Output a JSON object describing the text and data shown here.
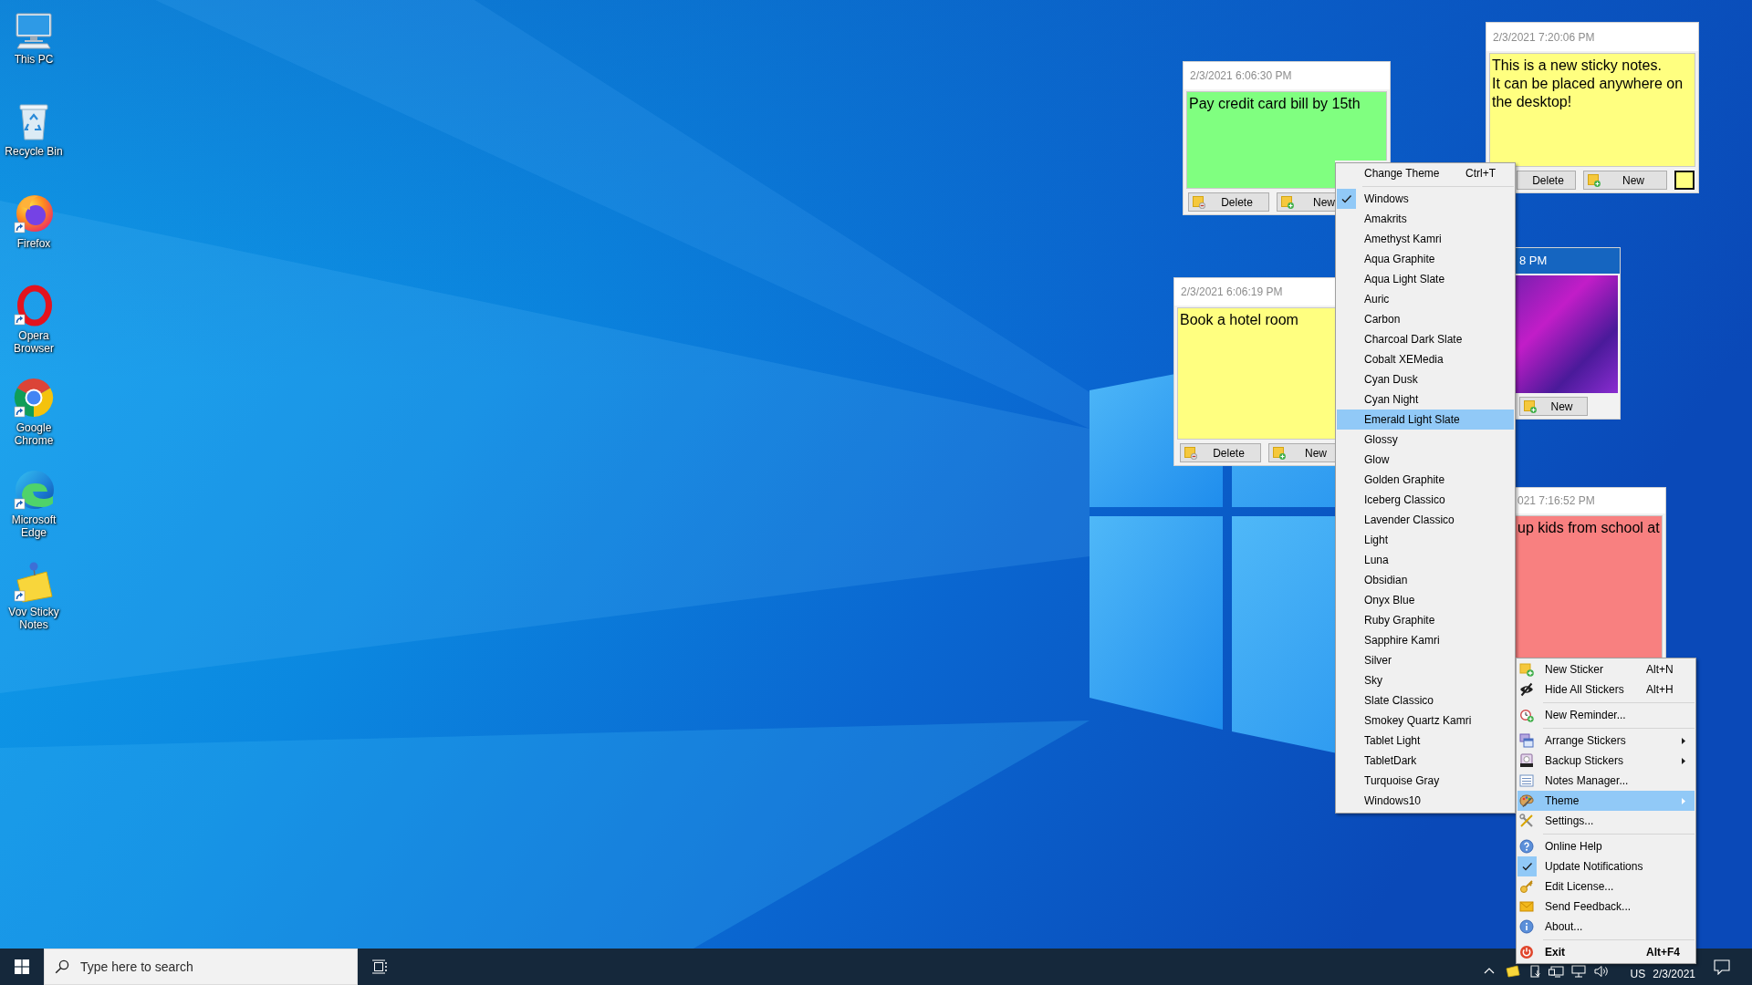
{
  "desktop_icons": [
    {
      "label": "This PC",
      "shortcut": false
    },
    {
      "label": "Recycle Bin",
      "shortcut": false
    },
    {
      "label": "Firefox",
      "shortcut": true
    },
    {
      "label": "Opera Browser",
      "shortcut": true
    },
    {
      "label": "Google Chrome",
      "shortcut": true
    },
    {
      "label": "Microsoft Edge",
      "shortcut": true
    },
    {
      "label": "Vov Sticky Notes",
      "shortcut": true
    }
  ],
  "notes": [
    {
      "kind": "text",
      "date": "2/3/2021 6:06:30 PM",
      "text": "Pay credit card bill by 15th",
      "color": "#80ff80",
      "active": false,
      "color_button": false,
      "buttons": [
        {
          "kind": "delete",
          "label": "Delete",
          "icon": true
        },
        {
          "kind": "new",
          "label": "New",
          "icon": true
        }
      ]
    },
    {
      "kind": "text",
      "date": "2/3/2021 7:20:06 PM",
      "text": "This is a new sticky notes.\nIt can be placed anywhere on the desktop!",
      "color": "#ffff80",
      "active": false,
      "color_button": true,
      "buttons": [
        {
          "kind": "delete",
          "label": "Delete",
          "icon": false
        },
        {
          "kind": "new",
          "label": "New",
          "icon": true
        }
      ]
    },
    {
      "kind": "text",
      "date": "2/3/2021 6:06:19 PM",
      "text": "Book a hotel room",
      "color": "#ffff80",
      "active": false,
      "color_button": false,
      "buttons": [
        {
          "kind": "delete",
          "label": "Delete",
          "icon": true
        },
        {
          "kind": "new",
          "label": "New",
          "icon": true
        }
      ]
    },
    {
      "kind": "photo",
      "date": "8 PM",
      "active": true,
      "color_button": false,
      "buttons": [
        {
          "kind": "new",
          "label": "New",
          "icon": true
        }
      ]
    },
    {
      "kind": "text",
      "date": "021 7:16:52 PM",
      "text": "up kids from school at",
      "color": "#f88080",
      "active": false
    }
  ],
  "theme_menu": {
    "title": {
      "label": "Change Theme",
      "shortcut": "Ctrl+T"
    },
    "items": [
      {
        "label": "Windows",
        "checked": true,
        "selected": false
      },
      {
        "label": "Amakrits",
        "checked": false,
        "selected": false
      },
      {
        "label": "Amethyst Kamri",
        "checked": false,
        "selected": false
      },
      {
        "label": "Aqua Graphite",
        "checked": false,
        "selected": false
      },
      {
        "label": "Aqua Light Slate",
        "checked": false,
        "selected": false
      },
      {
        "label": "Auric",
        "checked": false,
        "selected": false
      },
      {
        "label": "Carbon",
        "checked": false,
        "selected": false
      },
      {
        "label": "Charcoal Dark Slate",
        "checked": false,
        "selected": false
      },
      {
        "label": "Cobalt XEMedia",
        "checked": false,
        "selected": false
      },
      {
        "label": "Cyan Dusk",
        "checked": false,
        "selected": false
      },
      {
        "label": "Cyan Night",
        "checked": false,
        "selected": false
      },
      {
        "label": "Emerald Light Slate",
        "checked": false,
        "selected": true
      },
      {
        "label": "Glossy",
        "checked": false,
        "selected": false
      },
      {
        "label": "Glow",
        "checked": false,
        "selected": false
      },
      {
        "label": "Golden Graphite",
        "checked": false,
        "selected": false
      },
      {
        "label": "Iceberg Classico",
        "checked": false,
        "selected": false
      },
      {
        "label": "Lavender Classico",
        "checked": false,
        "selected": false
      },
      {
        "label": "Light",
        "checked": false,
        "selected": false
      },
      {
        "label": "Luna",
        "checked": false,
        "selected": false
      },
      {
        "label": "Obsidian",
        "checked": false,
        "selected": false
      },
      {
        "label": "Onyx Blue",
        "checked": false,
        "selected": false
      },
      {
        "label": "Ruby Graphite",
        "checked": false,
        "selected": false
      },
      {
        "label": "Sapphire Kamri",
        "checked": false,
        "selected": false
      },
      {
        "label": "Silver",
        "checked": false,
        "selected": false
      },
      {
        "label": "Sky",
        "checked": false,
        "selected": false
      },
      {
        "label": "Slate Classico",
        "checked": false,
        "selected": false
      },
      {
        "label": "Smokey Quartz Kamri",
        "checked": false,
        "selected": false
      },
      {
        "label": "Tablet Light",
        "checked": false,
        "selected": false
      },
      {
        "label": "TabletDark",
        "checked": false,
        "selected": false
      },
      {
        "label": "Turquoise Gray",
        "checked": false,
        "selected": false
      },
      {
        "label": "Windows10",
        "checked": false,
        "selected": false
      }
    ]
  },
  "main_menu": {
    "groups": [
      [
        {
          "label": "New Sticker",
          "shortcut": "Alt+N",
          "submenu": false,
          "checked": false,
          "selected": false,
          "default": false
        },
        {
          "label": "Hide All Stickers",
          "shortcut": "Alt+H",
          "submenu": false,
          "checked": false,
          "selected": false,
          "default": false
        }
      ],
      [
        {
          "label": "New Reminder...",
          "submenu": false,
          "checked": false,
          "selected": false,
          "default": false
        }
      ],
      [
        {
          "label": "Arrange Stickers",
          "submenu": true,
          "checked": false,
          "selected": false,
          "default": false
        },
        {
          "label": "Backup Stickers",
          "submenu": true,
          "checked": false,
          "selected": false,
          "default": false
        },
        {
          "label": "Notes Manager...",
          "submenu": false,
          "checked": false,
          "selected": false,
          "default": false
        },
        {
          "label": "Theme",
          "submenu": true,
          "checked": false,
          "selected": true,
          "default": false
        },
        {
          "label": "Settings...",
          "submenu": false,
          "checked": false,
          "selected": false,
          "default": false
        }
      ],
      [
        {
          "label": "Online Help",
          "submenu": false,
          "checked": false,
          "selected": false,
          "default": false
        },
        {
          "label": "Update Notifications",
          "submenu": false,
          "checked": true,
          "selected": false,
          "default": false
        },
        {
          "label": "Edit License...",
          "submenu": false,
          "checked": false,
          "selected": false,
          "default": false
        },
        {
          "label": "Send Feedback...",
          "submenu": false,
          "checked": false,
          "selected": false,
          "default": false
        },
        {
          "label": "About...",
          "submenu": false,
          "checked": false,
          "selected": false,
          "default": false
        }
      ],
      [
        {
          "label": "Exit",
          "shortcut": "Alt+F4",
          "submenu": false,
          "checked": false,
          "selected": false,
          "default": true
        }
      ]
    ]
  },
  "taskbar": {
    "search": {
      "placeholder": "Type here to search"
    },
    "language": "US",
    "date": "2/3/2021"
  }
}
